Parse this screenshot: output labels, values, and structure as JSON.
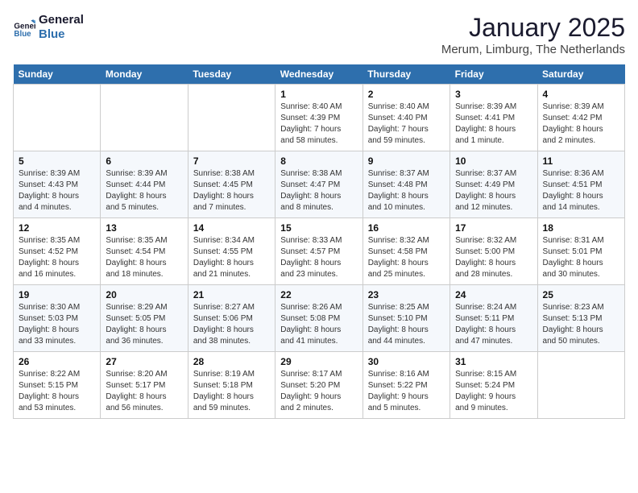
{
  "logo": {
    "line1": "General",
    "line2": "Blue"
  },
  "header": {
    "title": "January 2025",
    "subtitle": "Merum, Limburg, The Netherlands"
  },
  "days_of_week": [
    "Sunday",
    "Monday",
    "Tuesday",
    "Wednesday",
    "Thursday",
    "Friday",
    "Saturday"
  ],
  "weeks": [
    [
      {
        "day": "",
        "info": ""
      },
      {
        "day": "",
        "info": ""
      },
      {
        "day": "",
        "info": ""
      },
      {
        "day": "1",
        "info": "Sunrise: 8:40 AM\nSunset: 4:39 PM\nDaylight: 7 hours\nand 58 minutes."
      },
      {
        "day": "2",
        "info": "Sunrise: 8:40 AM\nSunset: 4:40 PM\nDaylight: 7 hours\nand 59 minutes."
      },
      {
        "day": "3",
        "info": "Sunrise: 8:39 AM\nSunset: 4:41 PM\nDaylight: 8 hours\nand 1 minute."
      },
      {
        "day": "4",
        "info": "Sunrise: 8:39 AM\nSunset: 4:42 PM\nDaylight: 8 hours\nand 2 minutes."
      }
    ],
    [
      {
        "day": "5",
        "info": "Sunrise: 8:39 AM\nSunset: 4:43 PM\nDaylight: 8 hours\nand 4 minutes."
      },
      {
        "day": "6",
        "info": "Sunrise: 8:39 AM\nSunset: 4:44 PM\nDaylight: 8 hours\nand 5 minutes."
      },
      {
        "day": "7",
        "info": "Sunrise: 8:38 AM\nSunset: 4:45 PM\nDaylight: 8 hours\nand 7 minutes."
      },
      {
        "day": "8",
        "info": "Sunrise: 8:38 AM\nSunset: 4:47 PM\nDaylight: 8 hours\nand 8 minutes."
      },
      {
        "day": "9",
        "info": "Sunrise: 8:37 AM\nSunset: 4:48 PM\nDaylight: 8 hours\nand 10 minutes."
      },
      {
        "day": "10",
        "info": "Sunrise: 8:37 AM\nSunset: 4:49 PM\nDaylight: 8 hours\nand 12 minutes."
      },
      {
        "day": "11",
        "info": "Sunrise: 8:36 AM\nSunset: 4:51 PM\nDaylight: 8 hours\nand 14 minutes."
      }
    ],
    [
      {
        "day": "12",
        "info": "Sunrise: 8:35 AM\nSunset: 4:52 PM\nDaylight: 8 hours\nand 16 minutes."
      },
      {
        "day": "13",
        "info": "Sunrise: 8:35 AM\nSunset: 4:54 PM\nDaylight: 8 hours\nand 18 minutes."
      },
      {
        "day": "14",
        "info": "Sunrise: 8:34 AM\nSunset: 4:55 PM\nDaylight: 8 hours\nand 21 minutes."
      },
      {
        "day": "15",
        "info": "Sunrise: 8:33 AM\nSunset: 4:57 PM\nDaylight: 8 hours\nand 23 minutes."
      },
      {
        "day": "16",
        "info": "Sunrise: 8:32 AM\nSunset: 4:58 PM\nDaylight: 8 hours\nand 25 minutes."
      },
      {
        "day": "17",
        "info": "Sunrise: 8:32 AM\nSunset: 5:00 PM\nDaylight: 8 hours\nand 28 minutes."
      },
      {
        "day": "18",
        "info": "Sunrise: 8:31 AM\nSunset: 5:01 PM\nDaylight: 8 hours\nand 30 minutes."
      }
    ],
    [
      {
        "day": "19",
        "info": "Sunrise: 8:30 AM\nSunset: 5:03 PM\nDaylight: 8 hours\nand 33 minutes."
      },
      {
        "day": "20",
        "info": "Sunrise: 8:29 AM\nSunset: 5:05 PM\nDaylight: 8 hours\nand 36 minutes."
      },
      {
        "day": "21",
        "info": "Sunrise: 8:27 AM\nSunset: 5:06 PM\nDaylight: 8 hours\nand 38 minutes."
      },
      {
        "day": "22",
        "info": "Sunrise: 8:26 AM\nSunset: 5:08 PM\nDaylight: 8 hours\nand 41 minutes."
      },
      {
        "day": "23",
        "info": "Sunrise: 8:25 AM\nSunset: 5:10 PM\nDaylight: 8 hours\nand 44 minutes."
      },
      {
        "day": "24",
        "info": "Sunrise: 8:24 AM\nSunset: 5:11 PM\nDaylight: 8 hours\nand 47 minutes."
      },
      {
        "day": "25",
        "info": "Sunrise: 8:23 AM\nSunset: 5:13 PM\nDaylight: 8 hours\nand 50 minutes."
      }
    ],
    [
      {
        "day": "26",
        "info": "Sunrise: 8:22 AM\nSunset: 5:15 PM\nDaylight: 8 hours\nand 53 minutes."
      },
      {
        "day": "27",
        "info": "Sunrise: 8:20 AM\nSunset: 5:17 PM\nDaylight: 8 hours\nand 56 minutes."
      },
      {
        "day": "28",
        "info": "Sunrise: 8:19 AM\nSunset: 5:18 PM\nDaylight: 8 hours\nand 59 minutes."
      },
      {
        "day": "29",
        "info": "Sunrise: 8:17 AM\nSunset: 5:20 PM\nDaylight: 9 hours\nand 2 minutes."
      },
      {
        "day": "30",
        "info": "Sunrise: 8:16 AM\nSunset: 5:22 PM\nDaylight: 9 hours\nand 5 minutes."
      },
      {
        "day": "31",
        "info": "Sunrise: 8:15 AM\nSunset: 5:24 PM\nDaylight: 9 hours\nand 9 minutes."
      },
      {
        "day": "",
        "info": ""
      }
    ]
  ]
}
